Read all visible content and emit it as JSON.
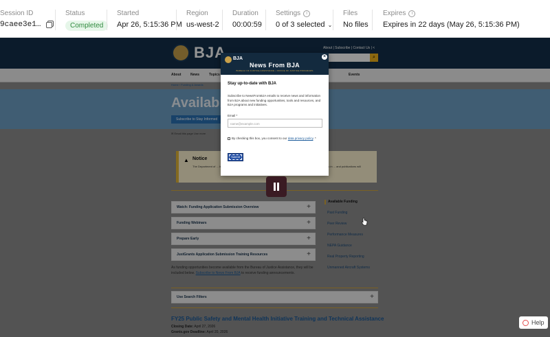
{
  "session_bar": {
    "session_id": {
      "label": "Session ID",
      "value": "9caee3e1…"
    },
    "status": {
      "label": "Status",
      "value": "Completed"
    },
    "started": {
      "label": "Started",
      "value": "Apr 26, 5:15:36 PM"
    },
    "region": {
      "label": "Region",
      "value": "us-west-2"
    },
    "duration": {
      "label": "Duration",
      "value": "00:00:59"
    },
    "settings": {
      "label": "Settings",
      "value": "0 of 3 selected"
    },
    "files": {
      "label": "Files",
      "value": "No files"
    },
    "expires": {
      "label": "Expires",
      "value": "Expires in 22 days (May 26, 5:15:36 PM)"
    }
  },
  "site": {
    "logo": "BJA",
    "top_links": "About  |  Subscribe  |  Contact Us  |  <",
    "nav": [
      "About",
      "News",
      "Topics",
      "Events"
    ],
    "breadcrumb": "Home › Funding & Awards",
    "hero_title": "Available",
    "hero_button": "Subscribe to Stay Informed",
    "email_note": "✉ Email this page  Use more",
    "notice": {
      "title": "Notice",
      "body": "The Department of ... in accordance with ... will be unavailable. We apologize for any inconvenience. ... materials in ... and publications will"
    },
    "accordions": [
      "Watch: Funding Application Submission Overview",
      "Funding Webinars",
      "Prepare Early",
      "JustGrants Application Submission Training Resources"
    ],
    "side_nav": [
      "Available Funding",
      "Past Funding",
      "Peer Review",
      "Performance Measures",
      "NEPA Guidance",
      "Real Property Reporting",
      "Unmanned Aircraft Systems"
    ],
    "paragraph_pre": "As funding opportunities become available from the Bureau of Justice Assistance, they will be included below. ",
    "paragraph_link": "Subscribe to News From BJA",
    "paragraph_post": " to receive funding announcements.",
    "filters_label": "Use Search Filters",
    "funding_title": "FY25 Public Safety and Mental Health Initiative Training and Technical Assistance",
    "closing_label": "Closing Date:",
    "closing_value": "April 27, 2026",
    "grants_label": "Grants.gov Deadline:",
    "grants_value": "April 20, 2026",
    "help": "Help"
  },
  "modal": {
    "brand": "BJA",
    "title": "News From BJA",
    "subtitle": "BUREAU OF JUSTICE ASSISTANCE • OFFICE OF JUSTICE PROGRAMS",
    "heading": "Stay up-to-date with BJA",
    "body": "Subscribe to NewsFromBJA emails to receive news and information from BJA about new funding opportunities, tools and resources, and BJA programs and initiatives.",
    "email_label": "Email *",
    "email_placeholder": "name@example.com",
    "consent_pre": "By checking this box, you consent to our ",
    "consent_link": "data privacy policy",
    "consent_post": ". *",
    "submit": "Submit"
  }
}
